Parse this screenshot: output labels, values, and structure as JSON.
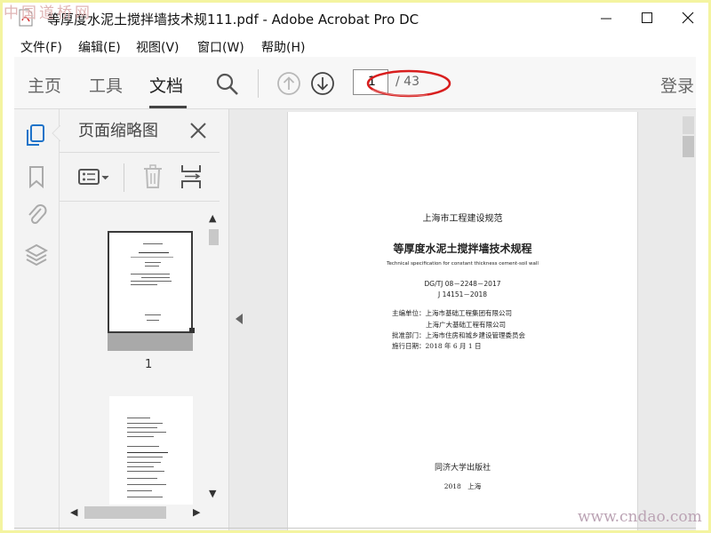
{
  "window": {
    "title": "等厚度水泥土搅拌墙技术规111.pdf - Adobe Acrobat Pro DC"
  },
  "menu": [
    "文件(F)",
    "编辑(E)",
    "视图(V)",
    "窗口(W)",
    "帮助(H)"
  ],
  "toolbar": {
    "tabs": [
      "主页",
      "工具",
      "文档"
    ],
    "active_tab": "文档",
    "page_current": "1",
    "page_total": "/ 43",
    "login": "登录"
  },
  "thumbnail_panel": {
    "title": "页面缩略图",
    "page1_label": "1"
  },
  "document": {
    "series": "上海市工程建设规范",
    "title": "等厚度水泥土搅拌墙技术规程",
    "title_en": "Technical specification for constant thickness cement-soil wall",
    "code1": "DG/TJ 08－2248－2017",
    "code2": "J 14151－2018",
    "editor1": "主编单位：上海市基础工程集团有限公司",
    "editor2": "上海广大基础工程有限公司",
    "approver": "批准部门：上海市住房和城乡建设管理委员会",
    "effective": "施行日期：2018 年 6 月 1 日",
    "publisher": "同济大学出版社",
    "pub_place": "2018　上海"
  },
  "watermarks": {
    "top_left": "中国道桥网",
    "bottom_right": "www.cndao.com"
  },
  "colors": {
    "highlight_ellipse": "#d81e1e",
    "frame_border": "#f4f4a0"
  }
}
